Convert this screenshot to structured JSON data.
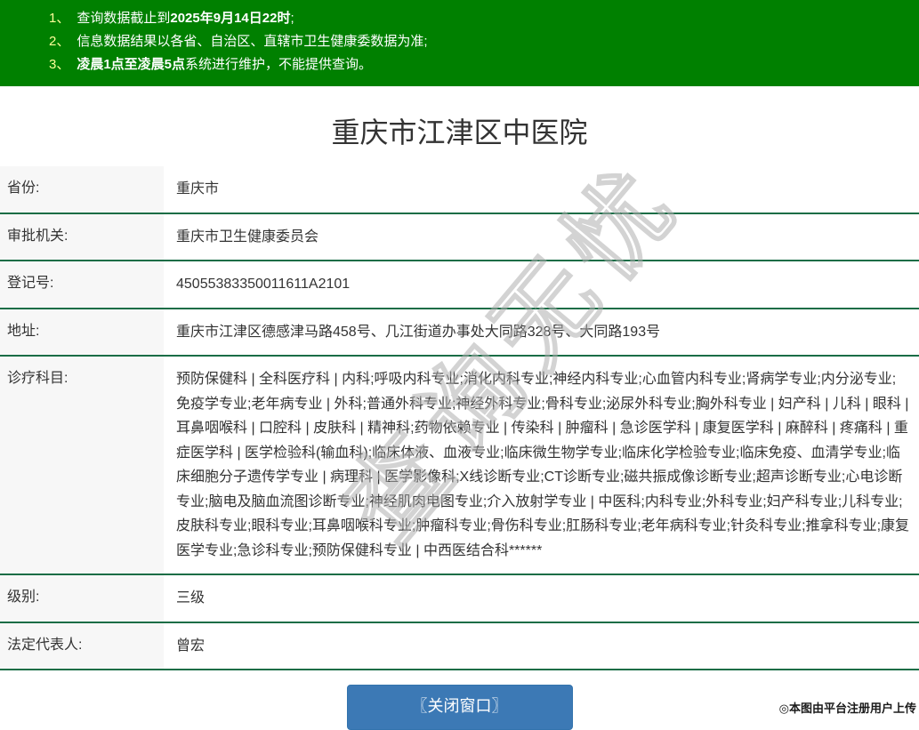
{
  "notices": [
    {
      "num": "1、",
      "pre": "查询数据截止到",
      "bold": "2025年9月14日22时",
      "post": ";"
    },
    {
      "num": "2、",
      "pre": "信息数据结果以各省、自治区、直辖市卫生健康委数据为准;",
      "bold": "",
      "post": ""
    },
    {
      "num": "3、",
      "pre": "",
      "bold": "凌晨1点至凌晨5点",
      "post": "系统进行维护，不能提供查询。"
    }
  ],
  "title": "重庆市江津区中医院",
  "fields": [
    {
      "label": "省份:",
      "value": "重庆市"
    },
    {
      "label": "审批机关:",
      "value": "重庆市卫生健康委员会"
    },
    {
      "label": "登记号:",
      "value": "45055383350011611A2101"
    },
    {
      "label": "地址:",
      "value": "重庆市江津区德感津马路458号、几江街道办事处大同路328号、大同路193号"
    },
    {
      "label": "诊疗科目:",
      "value": "预防保健科 | 全科医疗科 | 内科;呼吸内科专业;消化内科专业;神经内科专业;心血管内科专业;肾病学专业;内分泌专业;免疫学专业;老年病专业 | 外科;普通外科专业;神经外科专业;骨科专业;泌尿外科专业;胸外科专业 | 妇产科 | 儿科 | 眼科 | 耳鼻咽喉科 | 口腔科 | 皮肤科 | 精神科;药物依赖专业 | 传染科 | 肿瘤科 | 急诊医学科 | 康复医学科 | 麻醉科 | 疼痛科 | 重症医学科 | 医学检验科(输血科);临床体液、血液专业;临床微生物学专业;临床化学检验专业;临床免疫、血清学专业;临床细胞分子遗传学专业 | 病理科 | 医学影像科;X线诊断专业;CT诊断专业;磁共振成像诊断专业;超声诊断专业;心电诊断专业;脑电及脑血流图诊断专业;神经肌肉电图专业;介入放射学专业 | 中医科;内科专业;外科专业;妇产科专业;儿科专业;皮肤科专业;眼科专业;耳鼻咽喉科专业;肿瘤科专业;骨伤科专业;肛肠科专业;老年病科专业;针灸科专业;推拿科专业;康复医学专业;急诊科专业;预防保健科专业 | 中西医结合科******"
    },
    {
      "label": "级别:",
      "value": "三级"
    },
    {
      "label": "法定代表人:",
      "value": "曾宏"
    }
  ],
  "close_button_label": "〖关闭窗口〗",
  "watermark": "查询无忧",
  "footer_stamp": "◎本图由平台注册用户上传",
  "colors": {
    "header_green": "#008000",
    "divider_green": "#1a6d46",
    "button_blue": "#3c79b5",
    "notice_number_yellow": "#ffff99",
    "label_cell_bg": "#f7f7f7"
  }
}
